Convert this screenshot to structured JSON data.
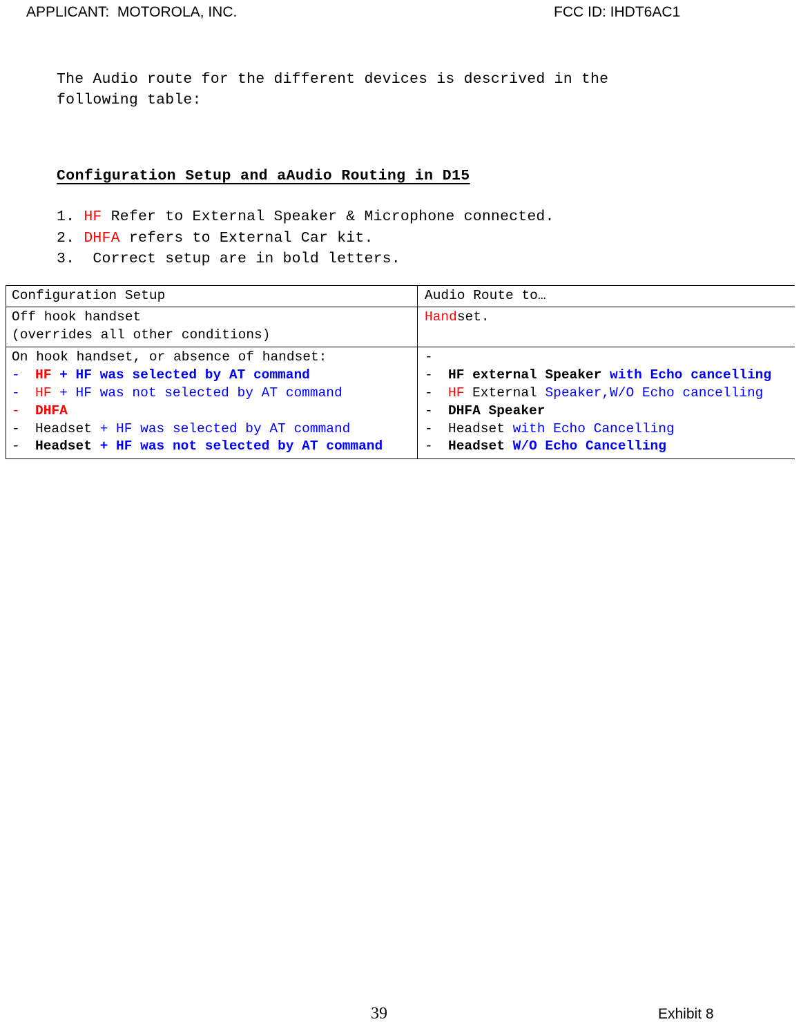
{
  "header": {
    "applicant": "APPLICANT:  MOTOROLA, INC.",
    "fcc_id": "FCC ID: IHDT6AC1"
  },
  "intro": {
    "text": "The Audio route for the different devices is descrived in the\nfollowing table:"
  },
  "section": {
    "heading": "Configuration Setup and aAudio Routing in D15"
  },
  "notes": [
    {
      "number": "1.",
      "parts": [
        {
          "text": "1. ",
          "color": "#000000",
          "bold": false
        },
        {
          "text": "HF",
          "color": "#FF0000",
          "bold": false
        },
        {
          "text": " Refer to External Speaker & Microphone connected.",
          "color": "#000000",
          "bold": false
        }
      ]
    },
    {
      "number": "2.",
      "parts": [
        {
          "text": "2. ",
          "color": "#000000",
          "bold": false
        },
        {
          "text": "DHFA",
          "color": "#FF0000",
          "bold": false
        },
        {
          "text": " refers to External Car kit.",
          "color": "#000000",
          "bold": false
        }
      ]
    },
    {
      "number": "3.",
      "parts": [
        {
          "text": "3.  Correct setup are in bold letters.",
          "color": "#000000",
          "bold": false
        }
      ]
    }
  ],
  "note_lines": {
    "l1_a": "1. ",
    "l1_b": "HF",
    "l1_c": " Refer to External Speaker & Microphone connected.",
    "l2_a": "2. ",
    "l2_b": "DHFA",
    "l2_c": " refers to External Car kit.",
    "l3": "3.  Correct setup are in bold letters."
  },
  "table": {
    "columns": [
      "Configuration Setup",
      "Audio Route to…"
    ],
    "rows": [
      {
        "left": {
          "lines": [
            "Off hook handset",
            "(overrides all other conditions)"
          ]
        },
        "right": {
          "lines": [
            "Handset."
          ]
        }
      },
      {
        "left": {
          "intro": "On hook handset, or absence of handset:",
          "bullets": [
            "HF + HF was selected by AT command",
            "HF + HF was not selected by AT command",
            "DHFA",
            "Headset + HF was selected by AT command",
            "Headset + HF was not selected by AT command"
          ]
        },
        "right": {
          "bullets": [
            "",
            "HF external Speaker with Echo cancelling",
            "HF External Speaker,W/O Echo cancelling",
            "DHFA Speaker",
            "Headset with Echo Cancelling",
            "Headset W/O Echo Cancelling"
          ]
        }
      }
    ],
    "cells": {
      "r1_left_l1": "Off hook handset",
      "r1_left_l2": "(overrides all other conditions)",
      "r1_right_hand": "Hand",
      "r1_right_set": "set.",
      "r2_left_intro": "On hook handset, or absence of handset:",
      "r2_left_b1_dash": "-",
      "r2_left_b1_p1": "HF",
      "r2_left_b1_p2": " + HF was selected by AT command",
      "r2_left_b2_dash": "-",
      "r2_left_b2_p1": "HF",
      "r2_left_b2_p2": " + HF was not selected by AT command",
      "r2_left_b3_dash": "-",
      "r2_left_b3_p1": "DHFA",
      "r2_left_b4_dash": "-",
      "r2_left_b4_p1": "Headset",
      "r2_left_b4_p2": " + HF was selected by AT command",
      "r2_left_b5_dash": "-",
      "r2_left_b5_p1": "Headset",
      "r2_left_b5_p2": " + HF was not selected by AT command",
      "r2_right_b0_dash": "-",
      "r2_right_b1_dash": "-",
      "r2_right_b1_p1": "HF external Speaker",
      "r2_right_b1_p2": " with Echo cancelling",
      "r2_right_b2_dash": "-",
      "r2_right_b2_p1": "HF",
      "r2_right_b2_p2": " External ",
      "r2_right_b2_p3": "Speaker,W/O Echo cancelling",
      "r2_right_b3_dash": "-",
      "r2_right_b3_p1": "DHFA Speaker",
      "r2_right_b4_dash": "-",
      "r2_right_b4_p1": "Headset",
      "r2_right_b4_p2": " with Echo Cancelling",
      "r2_right_b5_dash": "-",
      "r2_right_b5_p1": "Headset",
      "r2_right_b5_p2": " W/O Echo Cancelling"
    }
  },
  "footer": {
    "page_number": "39",
    "exhibit": "Exhibit 8"
  },
  "colors": {
    "red": "#FF0000",
    "blue": "#0000FF",
    "black": "#000000"
  }
}
